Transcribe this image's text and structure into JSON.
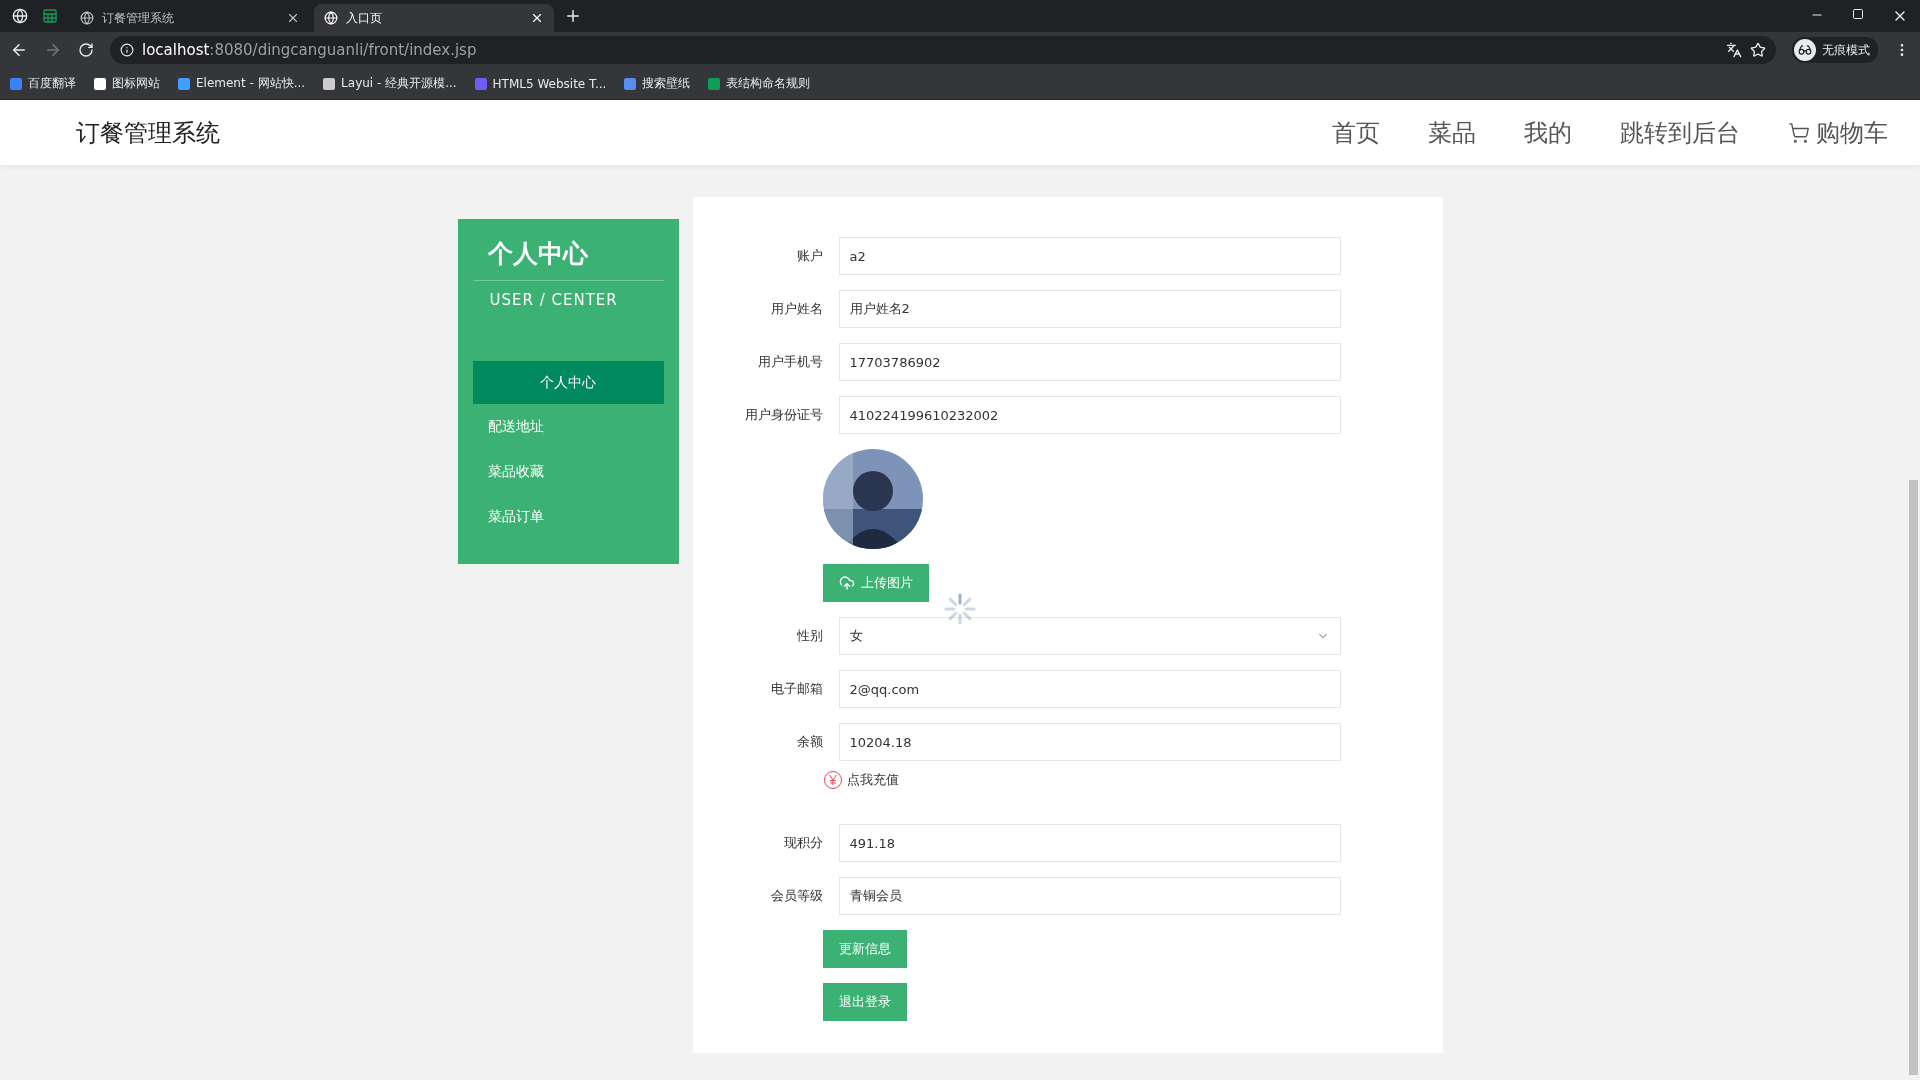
{
  "browser": {
    "tabs": [
      {
        "label": "订餐管理系统",
        "selected": false
      },
      {
        "label": "入口页",
        "selected": true
      }
    ],
    "url_host": "localhost",
    "url_path": ":8080/dingcanguanli/front/index.jsp",
    "profile": "无痕模式",
    "bookmarks": [
      {
        "label": "百度翻译",
        "color": "#3b82f6"
      },
      {
        "label": "图标网站",
        "color": "#ffffff"
      },
      {
        "label": "Element - 网站快...",
        "color": "#409eff"
      },
      {
        "label": "Layui - 经典开源模...",
        "color": "#cccccc"
      },
      {
        "label": "HTML5 Website T...",
        "color": "#6d5dfc"
      },
      {
        "label": "搜索壁纸",
        "color": "#5b8def"
      },
      {
        "label": "表结构命名规则",
        "color": "#0f9d58"
      }
    ]
  },
  "site": {
    "title": "订餐管理系统",
    "nav": [
      {
        "label": "首页",
        "kind": "text"
      },
      {
        "label": "菜品",
        "kind": "text"
      },
      {
        "label": "我的",
        "kind": "text"
      },
      {
        "label": "跳转到后台",
        "kind": "text"
      },
      {
        "label": "购物车",
        "kind": "cart"
      }
    ]
  },
  "sidebar": {
    "title": "个人中心",
    "subtitle": "USER / CENTER",
    "items": [
      {
        "label": "个人中心",
        "selected": true
      },
      {
        "label": "配送地址",
        "selected": false
      },
      {
        "label": "菜品收藏",
        "selected": false
      },
      {
        "label": "菜品订单",
        "selected": false
      }
    ]
  },
  "form": [
    {
      "kind": "input",
      "label": "账户",
      "value": "a2"
    },
    {
      "kind": "input",
      "label": "用户姓名",
      "value": "用户姓名2"
    },
    {
      "kind": "input",
      "label": "用户手机号",
      "value": "17703786902"
    },
    {
      "kind": "input",
      "label": "用户身份证号",
      "value": "410224199610232002"
    },
    {
      "kind": "avatar",
      "button": "上传图片"
    },
    {
      "kind": "select",
      "label": "性别",
      "value": "女"
    },
    {
      "kind": "input",
      "label": "电子邮箱",
      "value": "2@qq.com"
    },
    {
      "kind": "input",
      "label": "余额",
      "value": "10204.18"
    },
    {
      "kind": "link",
      "text": "点我充值"
    },
    {
      "kind": "input",
      "label": "现积分",
      "value": "491.18"
    },
    {
      "kind": "input",
      "label": "会员等级",
      "value": "青铜会员"
    },
    {
      "kind": "button",
      "label": "更新信息"
    },
    {
      "kind": "button",
      "label": "退出登录"
    }
  ]
}
